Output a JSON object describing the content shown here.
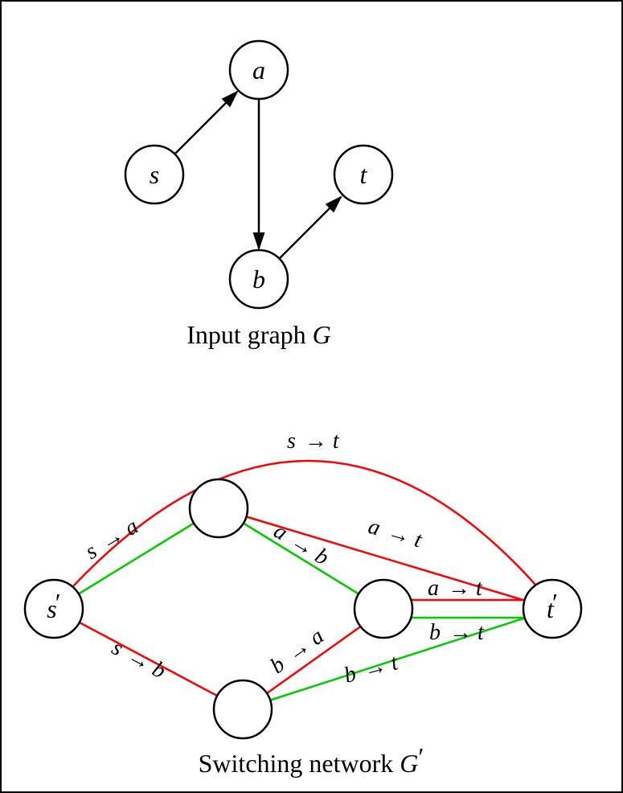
{
  "top_graph": {
    "caption_prefix": "Input graph ",
    "caption_G": "G",
    "nodes": {
      "s": "s",
      "a": "a",
      "b": "b",
      "t": "t"
    },
    "edges": [
      {
        "from": "s",
        "to": "a"
      },
      {
        "from": "a",
        "to": "b"
      },
      {
        "from": "b",
        "to": "t"
      }
    ]
  },
  "bottom_graph": {
    "caption_prefix": "Switching network ",
    "caption_G": "G",
    "caption_prime": "′",
    "nodes": {
      "sprime_s": "s",
      "sprime_prime": "′",
      "tprime_t": "t",
      "tprime_prime": "′"
    },
    "edge_labels": {
      "st": {
        "l": "s",
        "r": "t"
      },
      "sa": {
        "l": "s",
        "r": "a"
      },
      "sb": {
        "l": "s",
        "r": "b"
      },
      "ab": {
        "l": "a",
        "r": "b"
      },
      "at1": {
        "l": "a",
        "r": "t"
      },
      "at2": {
        "l": "a",
        "r": "t"
      },
      "ba": {
        "l": "b",
        "r": "a"
      },
      "bt1": {
        "l": "b",
        "r": "t"
      },
      "bt2": {
        "l": "b",
        "r": "t"
      }
    }
  },
  "chart_data": {
    "type": "graph-diagram",
    "graphs": [
      {
        "name": "G",
        "label": "Input graph G",
        "directed": true,
        "nodes": [
          "s",
          "a",
          "b",
          "t"
        ],
        "edges": [
          {
            "from": "s",
            "to": "a"
          },
          {
            "from": "a",
            "to": "b"
          },
          {
            "from": "b",
            "to": "t"
          }
        ]
      },
      {
        "name": "G'",
        "label": "Switching network G'",
        "directed": false,
        "nodes": [
          "s'",
          "n1",
          "n2",
          "n3",
          "t'"
        ],
        "edges": [
          {
            "from": "s'",
            "to": "t'",
            "label": "s → t",
            "color": "red"
          },
          {
            "from": "s'",
            "to": "n1",
            "label": "s → a",
            "color": "green"
          },
          {
            "from": "s'",
            "to": "n3",
            "label": "s → b",
            "color": "red"
          },
          {
            "from": "n1",
            "to": "n2",
            "label": "a → b",
            "color": "green"
          },
          {
            "from": "n1",
            "to": "t'",
            "label": "a → t",
            "color": "red"
          },
          {
            "from": "n2",
            "to": "t'",
            "label": "a → t",
            "color": "red"
          },
          {
            "from": "n3",
            "to": "n2",
            "label": "b → a",
            "color": "red"
          },
          {
            "from": "n2",
            "to": "t'",
            "label": "b → t",
            "color": "green"
          },
          {
            "from": "n3",
            "to": "t'",
            "label": "b → t",
            "color": "green"
          }
        ]
      }
    ]
  }
}
